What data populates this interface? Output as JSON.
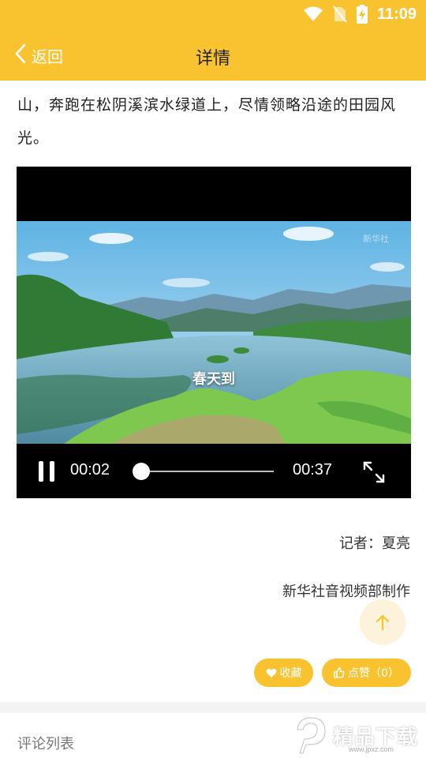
{
  "status_bar": {
    "time": "11:09",
    "icons": [
      "wifi-icon",
      "no-sim-icon",
      "battery-charging-icon"
    ]
  },
  "nav": {
    "back_label": "返回",
    "title": "详情"
  },
  "article": {
    "text": "山，奔跑在松阴溪滨水绿道上，尽情领略沿途的田园风光。"
  },
  "video": {
    "caption": "春天到",
    "watermark": "新华社",
    "current_time": "00:02",
    "total_time": "00:37",
    "progress": 0.054,
    "playing": true
  },
  "credits": {
    "reporter": "记者：夏亮",
    "producer": "新华社音视频部制作"
  },
  "actions": {
    "collect_label": "收藏",
    "like_label": "点赞（0）",
    "accent_color": "#f9c330"
  },
  "comments": {
    "title": "评论列表"
  },
  "brand": {
    "name": "精品下载",
    "url": "www.jpxz.com"
  }
}
